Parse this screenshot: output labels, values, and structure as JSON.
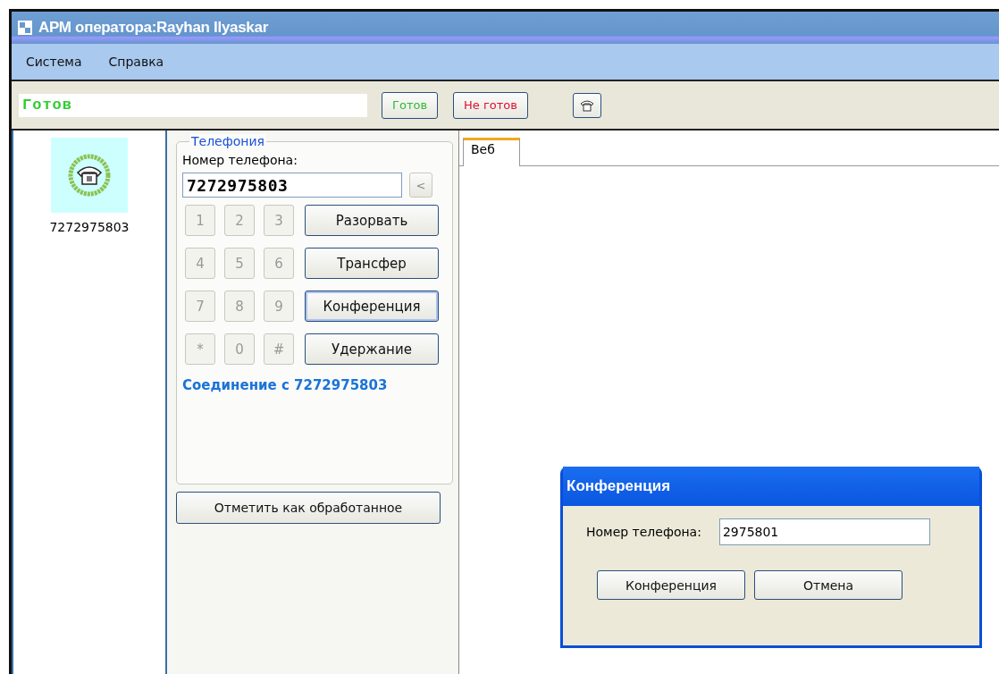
{
  "window": {
    "title": "АРМ оператора:Rayhan Ilyaskar"
  },
  "menu": [
    "Система",
    "Справка"
  ],
  "toolbar": {
    "status": "Готов",
    "buttons": [
      {
        "label": "Готов",
        "color": "#33bb33"
      },
      {
        "label": "Не готов",
        "color": "#dd1133"
      }
    ]
  },
  "calls": [
    {
      "number": "7272975803"
    }
  ],
  "telephony": {
    "title": "Телефония",
    "number_label": "Номер телефона:",
    "number": "7272975803",
    "backspace": "<",
    "keys": [
      {
        "label": "1",
        "disabled": true
      },
      {
        "label": "2",
        "disabled": true
      },
      {
        "label": "3",
        "disabled": true
      },
      {
        "label": "4",
        "disabled": true
      },
      {
        "label": "5",
        "disabled": true
      },
      {
        "label": "6",
        "disabled": true
      },
      {
        "label": "7",
        "disabled": true
      },
      {
        "label": "8",
        "disabled": true
      },
      {
        "label": "9",
        "disabled": true
      },
      {
        "label": "*",
        "disabled": true
      },
      {
        "label": "0",
        "disabled": true
      },
      {
        "label": "#",
        "disabled": true
      }
    ],
    "actions": [
      {
        "label": "Разорвать",
        "focused": false
      },
      {
        "label": "Трансфер",
        "focused": false
      },
      {
        "label": "Конференция",
        "focused": true
      },
      {
        "label": "Удержание",
        "focused": false
      }
    ],
    "connection": "Соединение с 7272975803"
  },
  "mark_button": "Отметить как обработанное",
  "tabs": [
    {
      "label": "Веб",
      "selected": true
    }
  ],
  "dialog": {
    "title": "Конференция",
    "label": "Номер телефона:",
    "value": "2975801",
    "buttons": [
      "Конференция",
      "Отмена"
    ]
  }
}
